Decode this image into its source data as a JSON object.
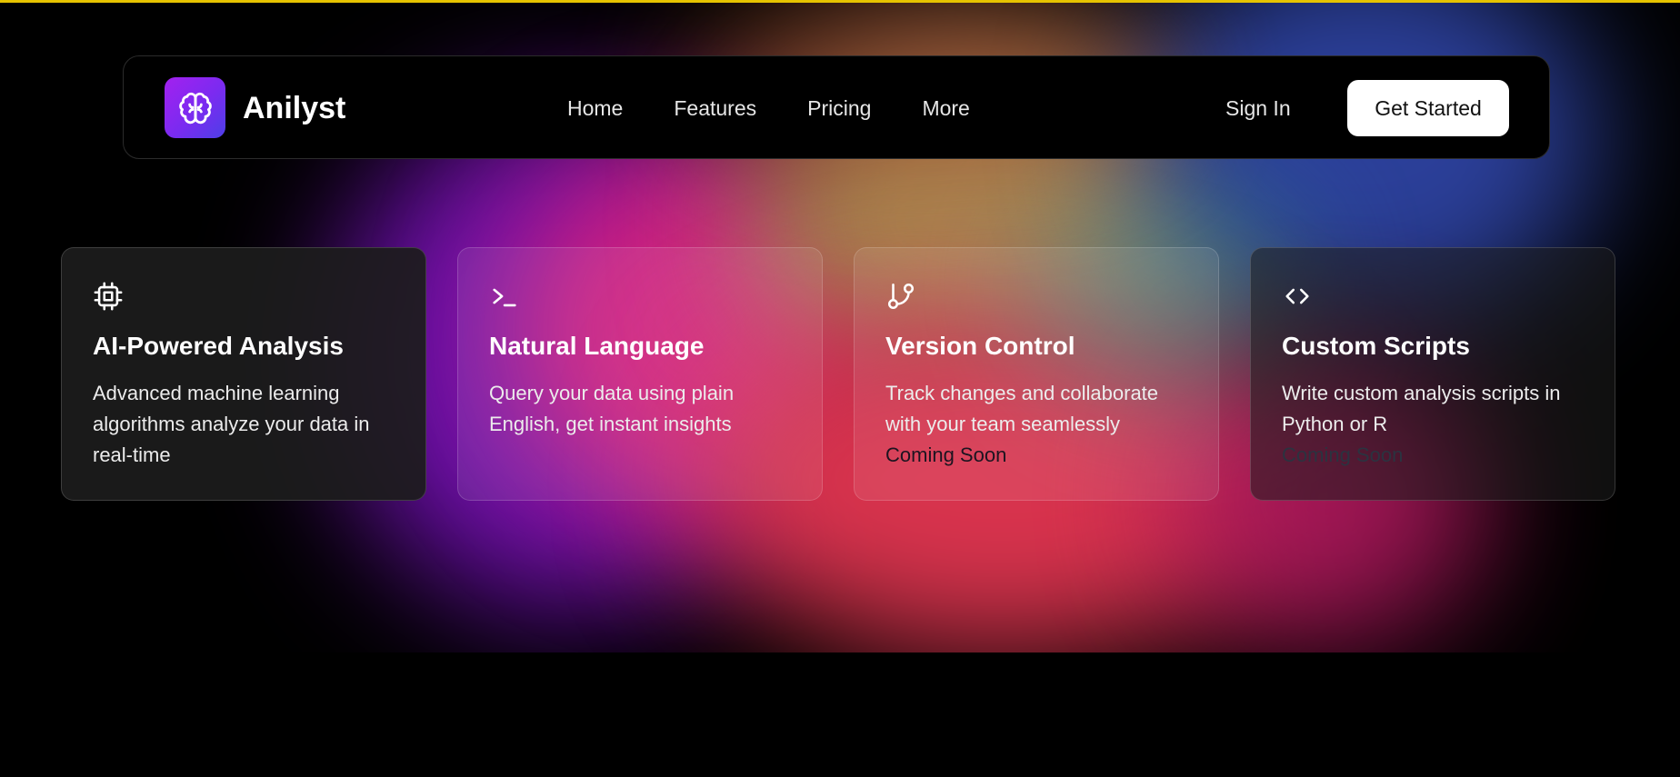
{
  "brand": {
    "name": "Anilyst",
    "logo_icon": "brain-icon",
    "logo_gradient": [
      "#a321ef",
      "#4d3fe8"
    ]
  },
  "nav": {
    "links": [
      "Home",
      "Features",
      "Pricing",
      "More"
    ],
    "sign_in": "Sign In",
    "get_started": "Get Started"
  },
  "features": [
    {
      "icon": "cpu-icon",
      "title": "AI-Powered Analysis",
      "description": "Advanced machine learning algorithms analyze your data in real-time",
      "badge": ""
    },
    {
      "icon": "terminal-icon",
      "title": "Natural Language",
      "description": "Query your data using plain English, get instant insights",
      "badge": ""
    },
    {
      "icon": "git-branch-icon",
      "title": "Version Control",
      "description": "Track changes and collaborate with your team seamlessly",
      "badge": "Coming Soon"
    },
    {
      "icon": "code-icon",
      "title": "Custom Scripts",
      "description": "Write custom analysis scripts in Python or R",
      "badge": "Coming Soon"
    }
  ],
  "colors": {
    "accent_top_border": "#e6c300",
    "background": "#000000",
    "button_bg": "#ffffff"
  }
}
